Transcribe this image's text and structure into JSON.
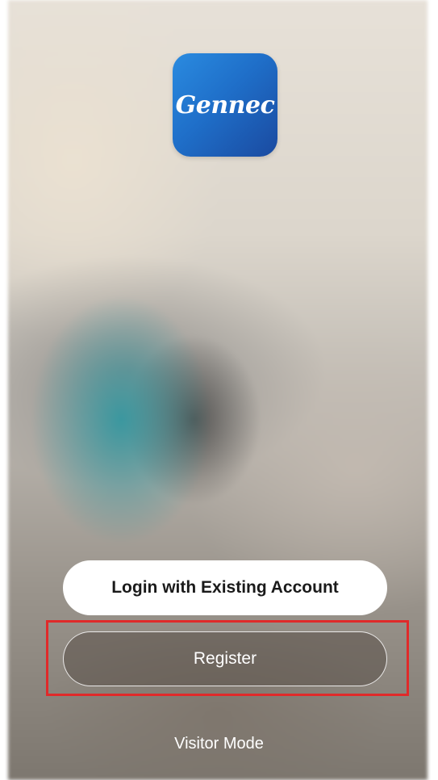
{
  "app": {
    "logo_text": "Gennec",
    "brand_colors": {
      "logo_gradient_start": "#2a8be0",
      "logo_gradient_end": "#1a4aa0",
      "highlight": "#e02a2a"
    }
  },
  "actions": {
    "login_label": "Login with Existing Account",
    "register_label": "Register",
    "visitor_label": "Visitor Mode"
  }
}
